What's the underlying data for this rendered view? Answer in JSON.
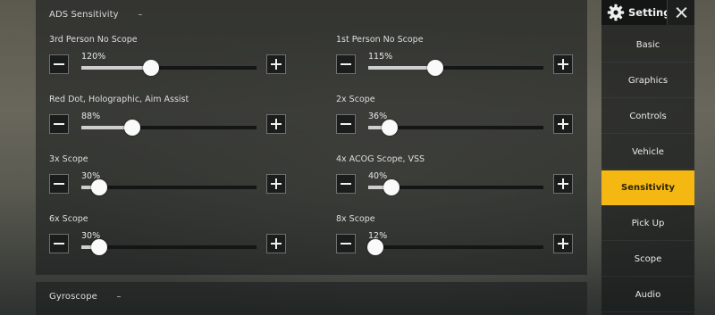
{
  "sections": {
    "ads_title": "ADS Sensitivity",
    "gyro_title": "Gyroscope"
  },
  "sliders": [
    {
      "label": "3rd Person No Scope",
      "value_text": "120%",
      "value": 120,
      "max": 300
    },
    {
      "label": "1st Person No Scope",
      "value_text": "115%",
      "value": 115,
      "max": 300
    },
    {
      "label": "Red Dot, Holographic, Aim Assist",
      "value_text": "88%",
      "value": 88,
      "max": 300
    },
    {
      "label": "2x Scope",
      "value_text": "36%",
      "value": 36,
      "max": 300
    },
    {
      "label": "3x Scope",
      "value_text": "30%",
      "value": 30,
      "max": 300
    },
    {
      "label": "4x ACOG Scope, VSS",
      "value_text": "40%",
      "value": 40,
      "max": 300
    },
    {
      "label": "6x Scope",
      "value_text": "30%",
      "value": 30,
      "max": 300
    },
    {
      "label": "8x Scope",
      "value_text": "12%",
      "value": 12,
      "max": 300
    }
  ],
  "sidebar": {
    "title": "Settings",
    "title_icon": "gear-icon",
    "close_icon": "close-icon",
    "items": [
      {
        "label": "Basic",
        "active": false
      },
      {
        "label": "Graphics",
        "active": false
      },
      {
        "label": "Controls",
        "active": false
      },
      {
        "label": "Vehicle",
        "active": false
      },
      {
        "label": "Sensitivity",
        "active": true
      },
      {
        "label": "Pick Up",
        "active": false
      },
      {
        "label": "Scope",
        "active": false
      },
      {
        "label": "Audio",
        "active": false
      }
    ]
  },
  "colors": {
    "accent": "#f5b813",
    "slider_fill": "#cfcfcf",
    "slider_track": "#141515",
    "panel_bg": "#1c1e1e"
  }
}
